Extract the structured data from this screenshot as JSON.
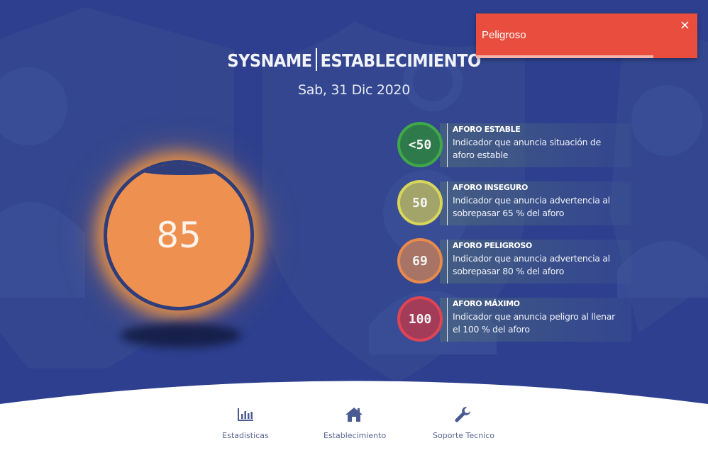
{
  "header": {
    "brand": "SYSNAME",
    "section": "ESTABLECIMIENTO",
    "date": "Sab, 31 Dic 2020"
  },
  "gauge": {
    "value": "85",
    "color": "#ee9050",
    "status": "peligroso"
  },
  "legend": [
    {
      "badge": "<50",
      "title": "AFORO ESTABLE",
      "description": "Indicador que anuncia situación de aforo estable",
      "ring": "#3fa94a",
      "fill": "#2f7a4a"
    },
    {
      "badge": "50",
      "title": "AFORO INSEGURO",
      "description": "Indicador que anuncia advertencia al sobrepasar 65 % del aforo",
      "ring": "#d8d65a",
      "fill": "#a2a46a"
    },
    {
      "badge": "69",
      "title": "AFORO PELIGROSO",
      "description": "Indicador que anuncia advertencia al sobrepasar 80 % del aforo",
      "ring": "#e88a4c",
      "fill": "#a77466"
    },
    {
      "badge": "100",
      "title": "AFORO MÁXIMO",
      "description": "Indicador que anuncia peligro al llenar el 100 % del aforo",
      "ring": "#e04553",
      "fill": "#a33c58"
    }
  ],
  "nav": [
    {
      "label": "Estadisticas",
      "icon": "bar-chart-icon"
    },
    {
      "label": "Establecimiento",
      "icon": "home-icon"
    },
    {
      "label": "Soporte Tecnico",
      "icon": "wrench-icon"
    }
  ],
  "toast": {
    "message": "Peligroso",
    "close": "×",
    "progress": 0.8,
    "color": "#e84d3d"
  },
  "colors": {
    "background": "#2d3f8e",
    "accent": "#4a5a92"
  }
}
